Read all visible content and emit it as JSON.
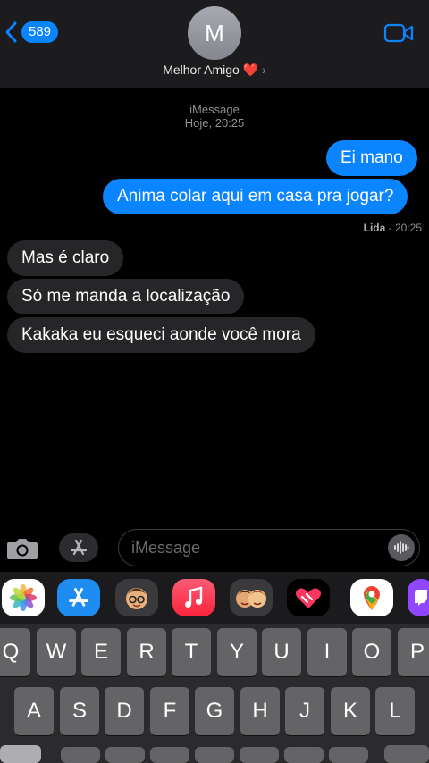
{
  "header": {
    "unread_count": "589",
    "avatar_initial": "M",
    "contact_name": "Melhor Amigo",
    "contact_emoji": "❤️"
  },
  "meta": {
    "service": "iMessage",
    "timestamp": "Hoje, 20:25"
  },
  "messages": [
    {
      "side": "out",
      "text": "Ei mano"
    },
    {
      "side": "out",
      "text": "Anima colar aqui em casa pra jogar?"
    },
    {
      "side": "in",
      "text": "Mas é claro"
    },
    {
      "side": "in",
      "text": "Só me manda a localização"
    },
    {
      "side": "in",
      "text": "Kakaka eu esqueci aonde você mora"
    }
  ],
  "read_receipt": {
    "label": "Lida",
    "time": "20:25"
  },
  "input": {
    "placeholder": "iMessage"
  },
  "keyboard": {
    "row1": [
      "Q",
      "W",
      "E",
      "R",
      "T",
      "Y",
      "U",
      "I",
      "O",
      "P"
    ],
    "row2": [
      "A",
      "S",
      "D",
      "F",
      "G",
      "H",
      "J",
      "K",
      "L"
    ]
  }
}
